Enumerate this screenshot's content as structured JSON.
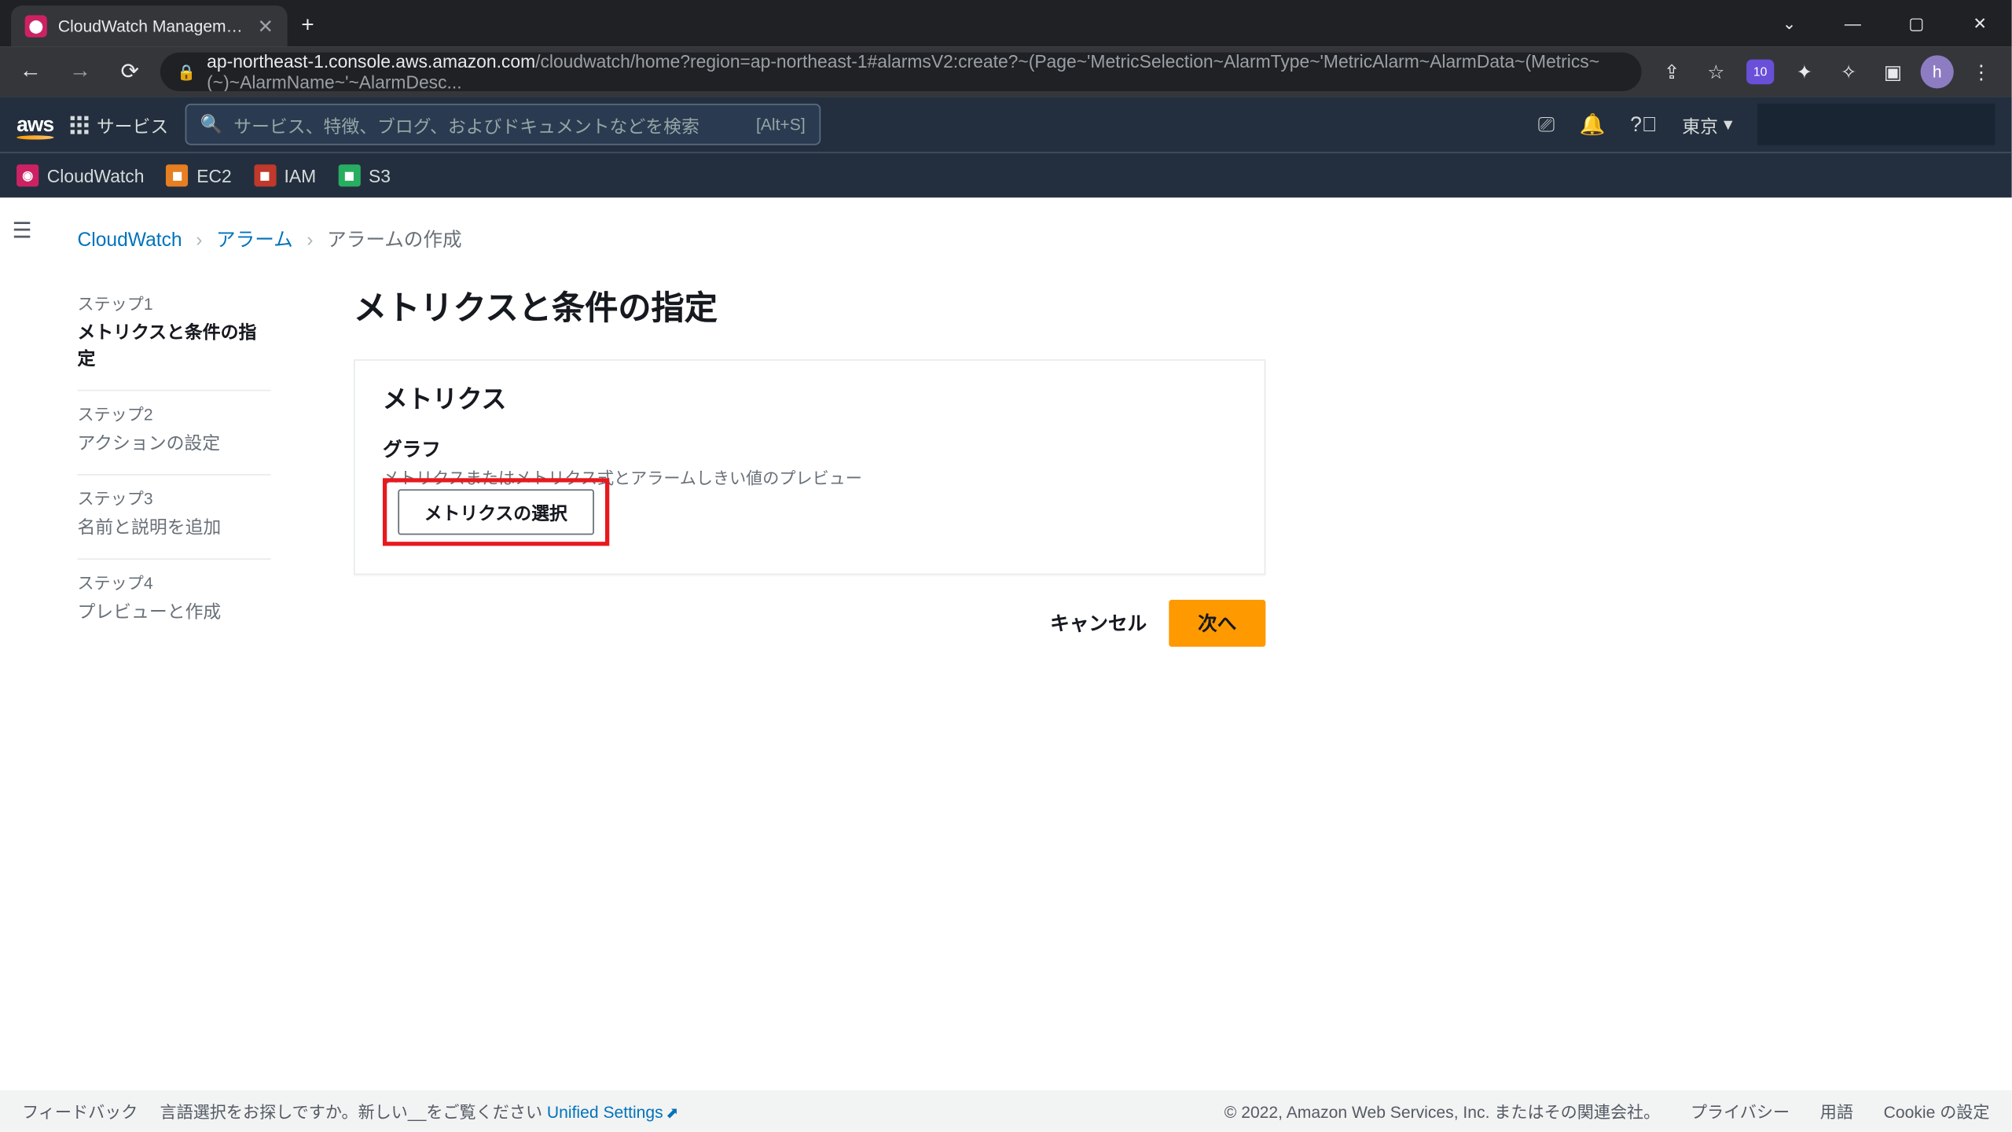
{
  "browser": {
    "tab_title": "CloudWatch Management Conso",
    "url_domain": "ap-northeast-1.console.aws.amazon.com",
    "url_path": "/cloudwatch/home?region=ap-northeast-1#alarmsV2:create?~(Page~'MetricSelection~AlarmType~'MetricAlarm~AlarmData~(Metrics~(~)~AlarmName~'~AlarmDesc...",
    "ext_badge": "10",
    "avatar_letter": "h"
  },
  "aws_nav": {
    "logo": "aws",
    "services": "サービス",
    "search_placeholder": "サービス、特徴、ブログ、およびドキュメントなどを検索",
    "search_kbd": "[Alt+S]",
    "region": "東京"
  },
  "service_bar": {
    "cloudwatch": "CloudWatch",
    "ec2": "EC2",
    "iam": "IAM",
    "s3": "S3"
  },
  "breadcrumb": {
    "cloudwatch": "CloudWatch",
    "alarms": "アラーム",
    "create": "アラームの作成"
  },
  "wizard": {
    "step1_label": "ステップ1",
    "step1_title": "メトリクスと条件の指定",
    "step2_label": "ステップ2",
    "step2_title": "アクションの設定",
    "step3_label": "ステップ3",
    "step3_title": "名前と説明を追加",
    "step4_label": "ステップ4",
    "step4_title": "プレビューと作成"
  },
  "page": {
    "title": "メトリクスと条件の指定",
    "card_title": "メトリクス",
    "graph_label": "グラフ",
    "graph_desc": "メトリクスまたはメトリクス式とアラームしきい値のプレビュー",
    "select_metric": "メトリクスの選択",
    "cancel": "キャンセル",
    "next": "次へ"
  },
  "footer": {
    "feedback": "フィードバック",
    "lang_hint": "言語選択をお探しですか。新しい__をご覧ください",
    "unified": "Unified Settings",
    "copyright": "© 2022, Amazon Web Services, Inc. またはその関連会社。",
    "privacy": "プライバシー",
    "terms": "用語",
    "cookie": "Cookie の設定"
  }
}
